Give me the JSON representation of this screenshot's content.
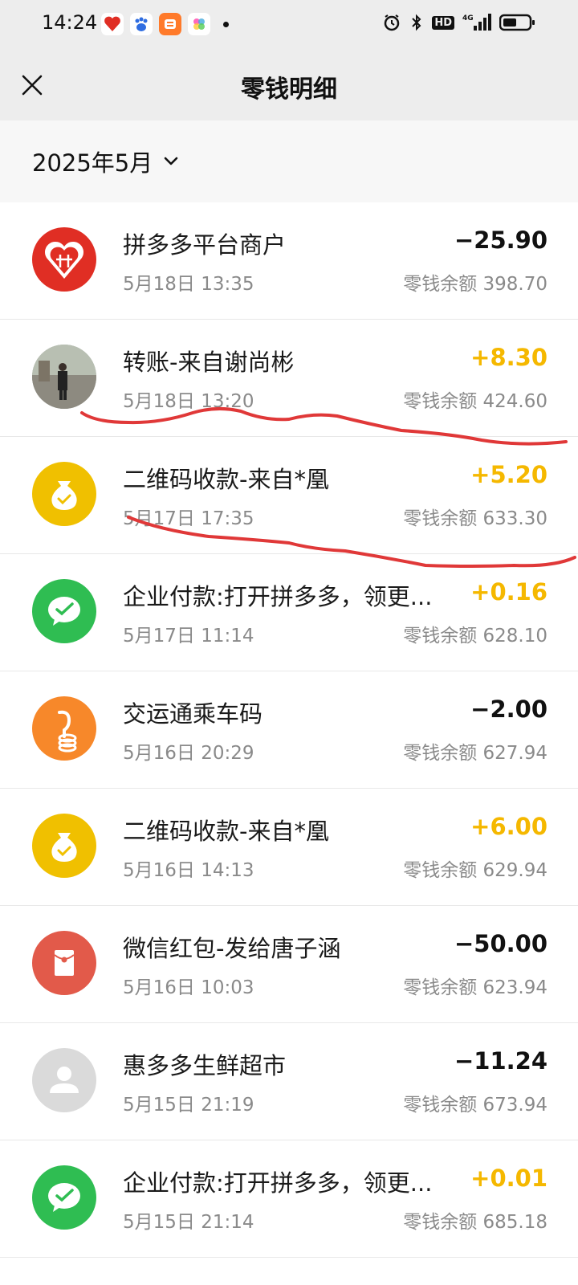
{
  "status_bar": {
    "time": "14:24",
    "app_icons": [
      "pinduoduo-icon",
      "baidu-icon",
      "taobao-icon",
      "photos-icon"
    ],
    "right_icons": [
      "alarm-icon",
      "bluetooth-icon",
      "hd-icon",
      "signal-icon",
      "battery-icon"
    ],
    "hd_label": "HD"
  },
  "header": {
    "title": "零钱明细",
    "close_icon": "close-icon"
  },
  "filter": {
    "month": "2025年5月"
  },
  "transactions": [
    {
      "title": "拼多多平台商户",
      "time": "5月18日 13:35",
      "amount": "−25.90",
      "direction": "out",
      "balance": "零钱余额 398.70",
      "icon": "pinduoduo-icon",
      "icon_color": "#e02e24"
    },
    {
      "title": "转账-来自谢尚彬",
      "time": "5月18日 13:20",
      "amount": "+8.30",
      "direction": "in",
      "balance": "零钱余额 424.60",
      "icon": "user-photo-avatar",
      "icon_color": "#8a9a7a"
    },
    {
      "title": "二维码收款-来自*凰",
      "time": "5月17日 17:35",
      "amount": "+5.20",
      "direction": "in",
      "balance": "零钱余额 633.30",
      "icon": "money-bag-icon",
      "icon_color": "#f0c000"
    },
    {
      "title": "企业付款:打开拼多多，领更...",
      "time": "5月17日 11:14",
      "amount": "+0.16",
      "direction": "in",
      "balance": "零钱余额 628.10",
      "icon": "wechat-pay-icon",
      "icon_color": "#2fbd52"
    },
    {
      "title": "交运通乘车码",
      "time": "5月16日 20:29",
      "amount": "−2.00",
      "direction": "out",
      "balance": "零钱余额 627.94",
      "icon": "transit-code-icon",
      "icon_color": "#f7882a"
    },
    {
      "title": "二维码收款-来自*凰",
      "time": "5月16日 14:13",
      "amount": "+6.00",
      "direction": "in",
      "balance": "零钱余额 629.94",
      "icon": "money-bag-icon",
      "icon_color": "#f0c000"
    },
    {
      "title": "微信红包-发给唐子涵",
      "time": "5月16日 10:03",
      "amount": "−50.00",
      "direction": "out",
      "balance": "零钱余额 623.94",
      "icon": "red-packet-icon",
      "icon_color": "#e25a4a"
    },
    {
      "title": "惠多多生鲜超市",
      "time": "5月15日 21:19",
      "amount": "−11.24",
      "direction": "out",
      "balance": "零钱余额 673.94",
      "icon": "default-user-icon",
      "icon_color": "#dadada"
    },
    {
      "title": "企业付款:打开拼多多，领更...",
      "time": "5月15日 21:14",
      "amount": "+0.01",
      "direction": "in",
      "balance": "零钱余额 685.18",
      "icon": "wechat-pay-icon",
      "icon_color": "#2fbd52"
    }
  ]
}
